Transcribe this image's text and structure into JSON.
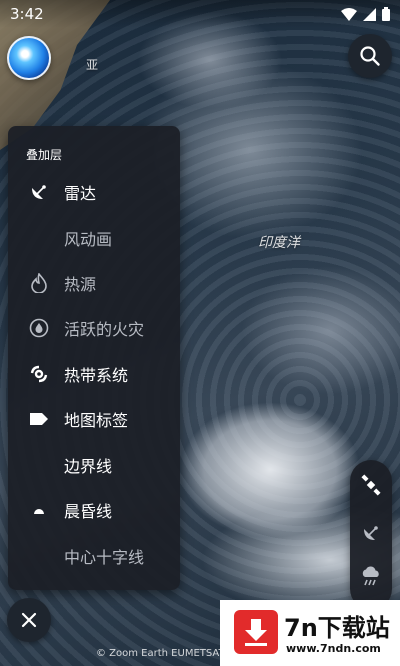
{
  "status_bar": {
    "time": "3:42"
  },
  "map": {
    "ocean_label": "印度洋",
    "top_label_partial": "亚"
  },
  "layers_panel": {
    "title": "叠加层",
    "items": [
      {
        "label": "雷达",
        "icon": "radar-dish-icon",
        "active": true
      },
      {
        "label": "风动画",
        "icon": "",
        "active": false
      },
      {
        "label": "热源",
        "icon": "flame-icon",
        "active": false
      },
      {
        "label": "活跃的火灾",
        "icon": "fire-circle-icon",
        "active": false
      },
      {
        "label": "热带系统",
        "icon": "hurricane-icon",
        "active": true
      },
      {
        "label": "地图标签",
        "icon": "tag-icon",
        "active": true
      },
      {
        "label": "边界线",
        "icon": "",
        "active": true
      },
      {
        "label": "晨昏线",
        "icon": "half-circle-icon",
        "active": true
      },
      {
        "label": "中心十字线",
        "icon": "",
        "active": false
      }
    ]
  },
  "right_toolbar": {
    "tools": [
      "satellite-icon",
      "radar-dish-icon",
      "rain-cloud-icon"
    ]
  },
  "attribution": "© Zoom Earth  EUMETSAT",
  "watermark": {
    "title": "7n下载站",
    "url": "www.7ndn.com"
  },
  "colors": {
    "panel": "#1c1f26",
    "active_text": "#ffffff",
    "inactive_text": "#b8bcc4",
    "brand_red": "#e22b2b"
  }
}
